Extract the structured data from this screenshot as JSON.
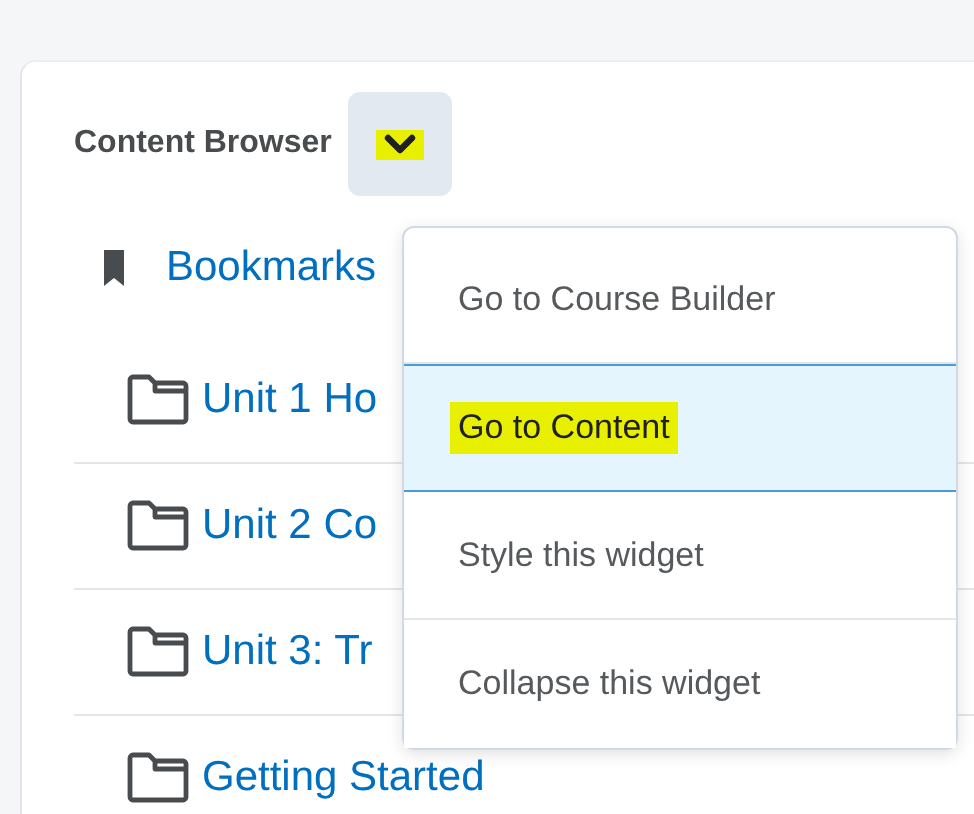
{
  "widget": {
    "title": "Content Browser",
    "menu_button": {
      "highlighted": true
    }
  },
  "items": [
    {
      "kind": "bookmark",
      "label": "Bookmarks"
    },
    {
      "kind": "folder",
      "label": "Unit 1 Ho"
    },
    {
      "kind": "folder",
      "label": "Unit 2 Co"
    },
    {
      "kind": "folder",
      "label": "Unit 3: Tr"
    },
    {
      "kind": "folder",
      "label": "Getting Started"
    }
  ],
  "menu": [
    {
      "label": "Go to Course Builder",
      "selected": false,
      "highlighted": false
    },
    {
      "label": "Go to Content",
      "selected": true,
      "highlighted": true
    },
    {
      "label": "Style this widget",
      "selected": false,
      "highlighted": false
    },
    {
      "label": "Collapse this widget",
      "selected": false,
      "highlighted": false
    }
  ]
}
